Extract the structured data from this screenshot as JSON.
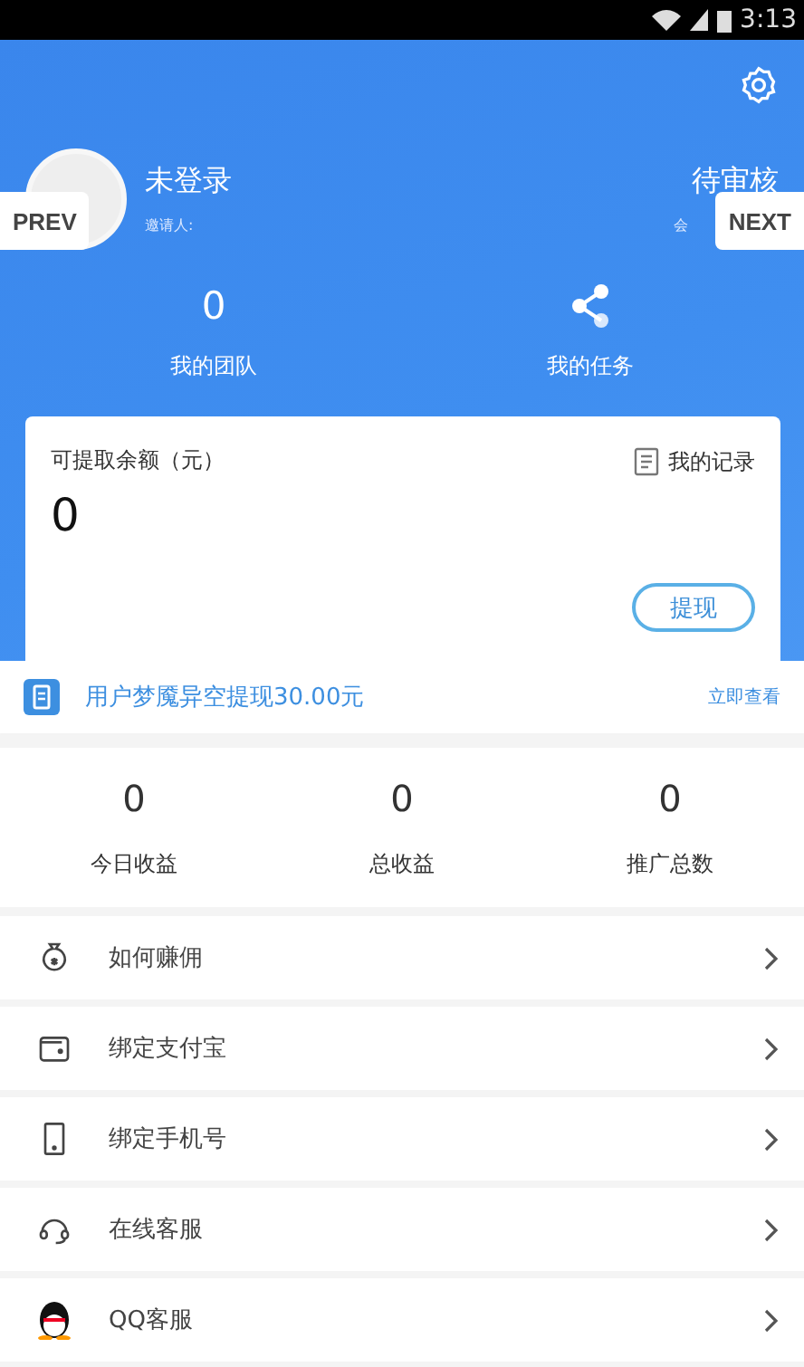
{
  "status_bar": {
    "time": "3:13"
  },
  "profile": {
    "name": "未登录",
    "inviter_label": "邀请人:",
    "status": "待审核",
    "status_sub": "会"
  },
  "quick_stats": [
    {
      "kind": "number",
      "value": "0",
      "label": "我的团队"
    },
    {
      "kind": "share",
      "label": "我的任务"
    }
  ],
  "balance_card": {
    "title": "可提取余额（元）",
    "amount": "0",
    "records_link": "我的记录",
    "withdraw_button": "提现"
  },
  "notice": {
    "text": "用户梦魇异空提现30.00元",
    "link": "立即查看"
  },
  "earnings": [
    {
      "value": "0",
      "label": "今日收益"
    },
    {
      "value": "0",
      "label": "总收益"
    },
    {
      "value": "0",
      "label": "推广总数"
    }
  ],
  "menu": [
    {
      "kind": "money",
      "label": "如何赚佣"
    },
    {
      "kind": "wallet",
      "label": "绑定支付宝"
    },
    {
      "kind": "phone",
      "label": "绑定手机号"
    },
    {
      "kind": "headset",
      "label": "在线客服"
    },
    {
      "kind": "penguin",
      "label": "QQ客服"
    }
  ],
  "pager": {
    "prev": "PREV",
    "next": "NEXT"
  }
}
